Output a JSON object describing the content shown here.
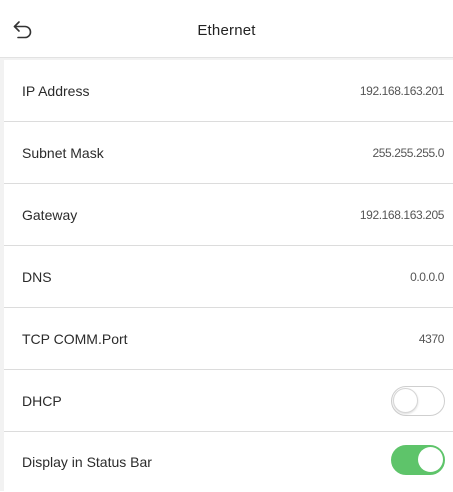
{
  "header": {
    "title": "Ethernet",
    "back_icon": "back-arrow-icon"
  },
  "rows": [
    {
      "label": "IP Address",
      "value": "192.168.163.201"
    },
    {
      "label": "Subnet Mask",
      "value": "255.255.255.0"
    },
    {
      "label": "Gateway",
      "value": "192.168.163.205"
    },
    {
      "label": "DNS",
      "value": "0.0.0.0"
    },
    {
      "label": "TCP COMM.Port",
      "value": "4370"
    }
  ],
  "toggles": [
    {
      "label": "DHCP",
      "state": "off"
    },
    {
      "label": "Display in Status Bar",
      "state": "on"
    }
  ],
  "colors": {
    "toggle_on": "#5ec46a",
    "toggle_off_border": "#cfcfcf",
    "background": "#f2f2f2"
  }
}
